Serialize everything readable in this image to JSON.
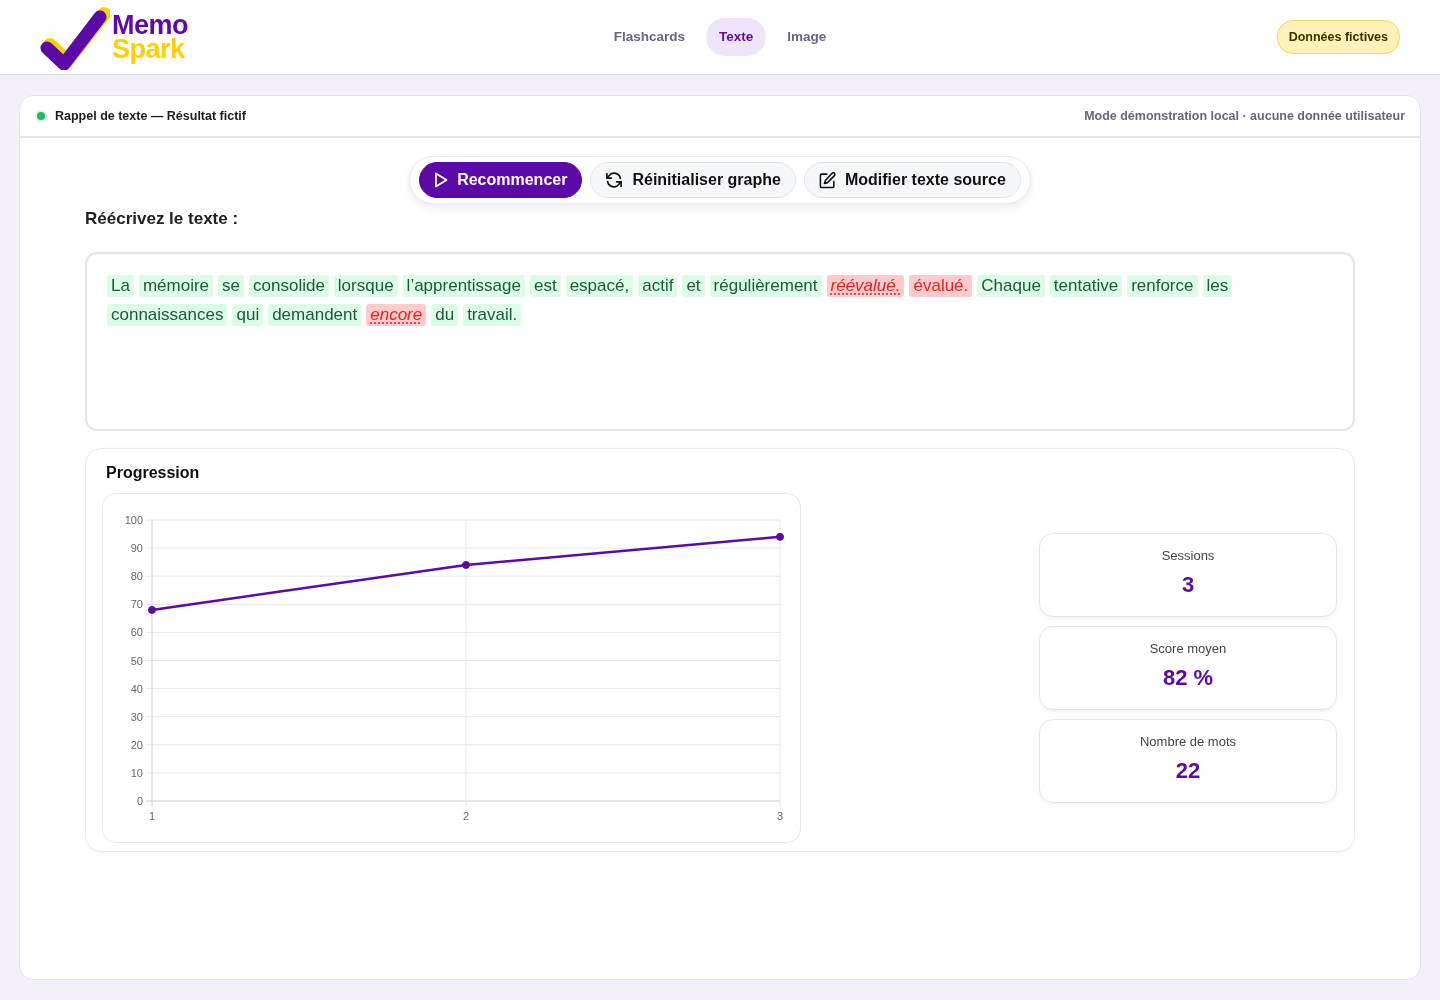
{
  "header": {
    "logo": {
      "line_1": "Memo",
      "line_2": "Spark"
    },
    "nav": [
      {
        "label": "Flashcards",
        "selected": false
      },
      {
        "label": "Texte",
        "selected": true
      },
      {
        "label": "Image",
        "selected": false
      }
    ],
    "badge": "Données fictives"
  },
  "panel": {
    "title": "Rappel de texte — Résultat fictif",
    "note": "Mode démonstration local · aucune donnée utilisateur"
  },
  "toolbar": [
    {
      "label": "Recommencer",
      "kind": "primary"
    },
    {
      "label": "Réinitialiser graphe",
      "kind": "secondary"
    },
    {
      "label": "Modifier texte source",
      "kind": "secondary"
    }
  ],
  "prompt": "Réécrivez le texte :",
  "answer": {
    "words": [
      {
        "text": "La",
        "kind": "correct"
      },
      {
        "text": "mémoire",
        "kind": "correct"
      },
      {
        "text": "se",
        "kind": "correct"
      },
      {
        "text": "consolide",
        "kind": "correct"
      },
      {
        "text": "lorsque",
        "kind": "correct"
      },
      {
        "text": "l’apprentissage",
        "kind": "correct"
      },
      {
        "text": "est",
        "kind": "correct"
      },
      {
        "text": "espacé,",
        "kind": "correct"
      },
      {
        "text": "actif",
        "kind": "correct"
      },
      {
        "text": "et",
        "kind": "correct"
      },
      {
        "text": "régulièrement",
        "kind": "correct"
      },
      {
        "text": "réévalué.",
        "kind": "wrong"
      },
      {
        "text": "évalué.",
        "kind": "missing"
      },
      {
        "text": "Chaque",
        "kind": "correct"
      },
      {
        "text": "tentative",
        "kind": "correct"
      },
      {
        "text": "renforce",
        "kind": "correct"
      },
      {
        "text": "les",
        "kind": "correct"
      },
      {
        "text": "connaissances",
        "kind": "correct"
      },
      {
        "text": "qui",
        "kind": "correct"
      },
      {
        "text": "demandent",
        "kind": "correct"
      },
      {
        "text": "encore",
        "kind": "wrong"
      },
      {
        "text": "du",
        "kind": "correct"
      },
      {
        "text": "travail.",
        "kind": "correct"
      }
    ]
  },
  "progress": {
    "title": "Progression",
    "chart_data": {
      "type": "line",
      "categories": [
        "1",
        "2",
        "3"
      ],
      "series": [
        {
          "color": "#5b0aa8",
          "marker": true,
          "values": [
            68,
            84,
            94
          ]
        }
      ],
      "ylim": [
        0,
        100
      ],
      "yticks": [
        0,
        10,
        20,
        30,
        40,
        50,
        60,
        70,
        80,
        90,
        100
      ],
      "grid": true
    },
    "stats": [
      {
        "label": "Sessions",
        "value": "3"
      },
      {
        "label": "Score moyen",
        "value": "82 %"
      },
      {
        "label": "Nombre de mots",
        "value": "22"
      }
    ]
  }
}
